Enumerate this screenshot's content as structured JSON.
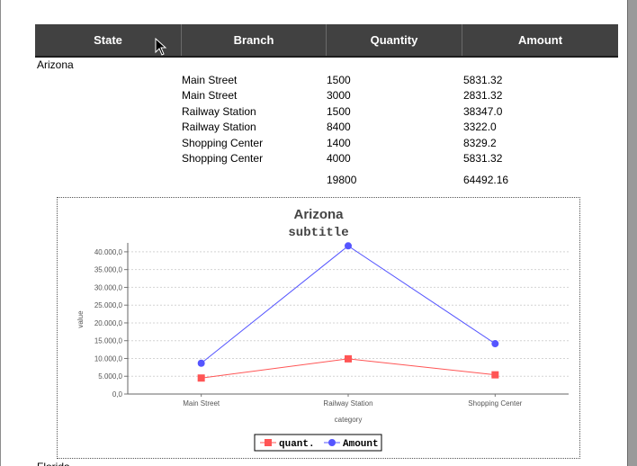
{
  "table": {
    "headers": [
      "State",
      "Branch",
      "Quantity",
      "Amount"
    ],
    "group_state": "Arizona",
    "rows": [
      {
        "branch": "Main Street",
        "quantity": "1500",
        "amount": "5831.32"
      },
      {
        "branch": "Main Street",
        "quantity": "3000",
        "amount": "2831.32"
      },
      {
        "branch": "Railway Station",
        "quantity": "1500",
        "amount": "38347.0"
      },
      {
        "branch": "Railway Station",
        "quantity": "8400",
        "amount": "3322.0"
      },
      {
        "branch": "Shopping Center",
        "quantity": "1400",
        "amount": "8329.2"
      },
      {
        "branch": "Shopping Center",
        "quantity": "4000",
        "amount": "5831.32"
      }
    ],
    "total_quantity": "19800",
    "total_amount": "64492.16"
  },
  "next_group_label": "Florida",
  "chart_data": {
    "type": "line",
    "title": "Arizona",
    "subtitle": "subtitle",
    "xlabel": "category",
    "ylabel": "value",
    "categories": [
      "Main Street",
      "Railway Station",
      "Shopping Center"
    ],
    "ylim": [
      0,
      42000
    ],
    "yticks": [
      0,
      5000,
      10000,
      15000,
      20000,
      25000,
      30000,
      35000,
      40000
    ],
    "ytick_labels": [
      "0,0",
      "5.000,0",
      "10.000,0",
      "15.000,0",
      "20.000,0",
      "25.000,0",
      "30.000,0",
      "35.000,0",
      "40.000,0"
    ],
    "grid": true,
    "legend_position": "bottom",
    "series": [
      {
        "name": "quant.",
        "values": [
          4500,
          9900,
          5400
        ],
        "color": "#ff5555",
        "marker": "square"
      },
      {
        "name": "Amount",
        "values": [
          8662.64,
          41669.0,
          14160.52
        ],
        "color": "#5555ff",
        "marker": "circle"
      }
    ]
  }
}
